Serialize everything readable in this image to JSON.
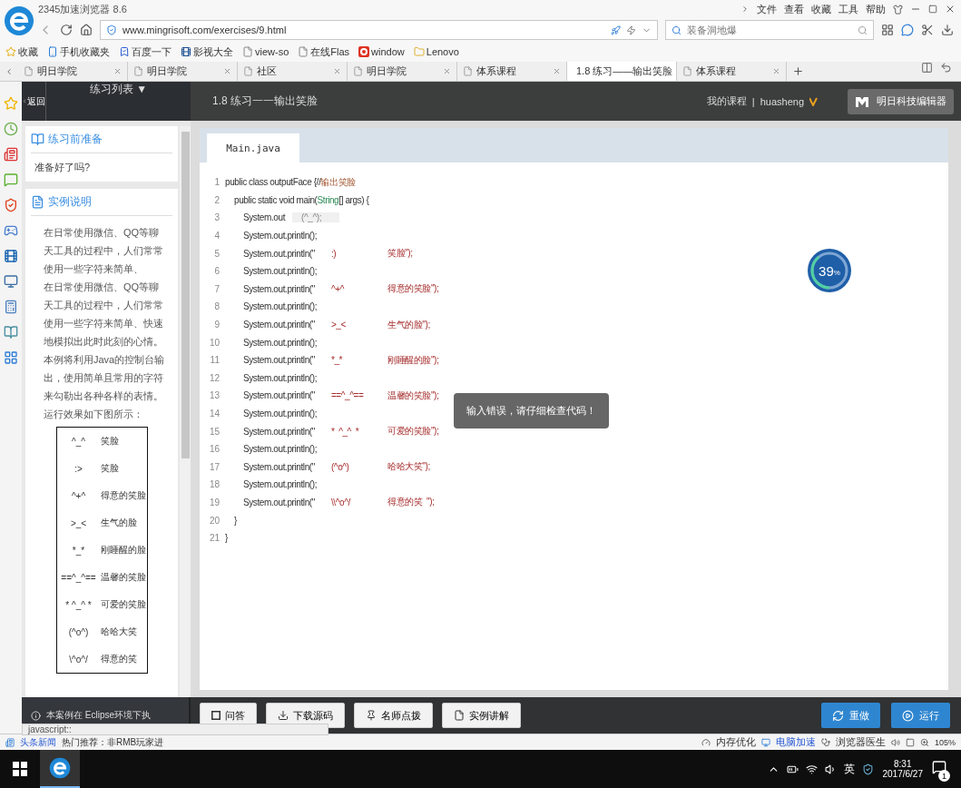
{
  "browser": {
    "title": "2345加速浏览器 8.6",
    "menu": [
      "文件",
      "查看",
      "收藏",
      "工具",
      "帮助"
    ],
    "address": "www.mingrisoft.com/exercises/9.html",
    "search": {
      "placeholder": "装备洞地爆"
    },
    "bookmarks": [
      {
        "label": "收藏",
        "kind": "star"
      },
      {
        "label": "手机收藏夹",
        "kind": "phone"
      },
      {
        "label": "百度一下",
        "kind": "paw"
      },
      {
        "label": "影视大全",
        "kind": "film"
      },
      {
        "label": "view-so",
        "kind": "page"
      },
      {
        "label": "在线Flas",
        "kind": "page"
      },
      {
        "label": "window",
        "kind": "red"
      },
      {
        "label": "Lenovo",
        "kind": "folder"
      }
    ],
    "tabs": [
      {
        "label": "明日学院",
        "selected": false
      },
      {
        "label": "明日学院",
        "selected": false
      },
      {
        "label": "社区",
        "selected": false
      },
      {
        "label": "明日学院",
        "selected": false
      },
      {
        "label": "体系课程",
        "selected": false
      },
      {
        "label": "1.8 练习——输出笑脸",
        "selected": true
      },
      {
        "label": "体系课程",
        "selected": false
      }
    ]
  },
  "header": {
    "back": "返回",
    "list_menu": "练习列表 ▼",
    "title": "1.8 练习一一输出笑脸",
    "my_courses": "我的课程",
    "separator": "|",
    "user": "huasheng",
    "editor_button": "明日科技编辑器"
  },
  "sidebar": {
    "prep": {
      "title": "练习前准备",
      "text": "准备好了吗?"
    },
    "example": {
      "title": "实例说明",
      "paragraphs": [
        "在日常使用微信、QQ等聊天工具的过程中，人们常常使用一些字符来简单、",
        "在日常使用微信、QQ等聊天工具的过程中，人们常常使用一些字符来简单、快速地模拟出此时此刻的心情。本例将利用Java的控制台输出，使用简单且常用的字符来勾勒出各种各样的表情。运行效果如下图所示："
      ],
      "faces": [
        {
          "face": "^_^",
          "meaning": "笑脸"
        },
        {
          "face": ":>",
          "meaning": "笑脸"
        },
        {
          "face": "^+^",
          "meaning": "得意的笑脸"
        },
        {
          "face": ">_<",
          "meaning": "生气的脸"
        },
        {
          "face": "*_*",
          "meaning": "刚睡醒的脸"
        },
        {
          "face": "==^_^==",
          "meaning": "温馨的笑脸"
        },
        {
          "face": "* ^_^ *",
          "meaning": "可爱的笑脸"
        },
        {
          "face": "(^o^)",
          "meaning": "哈哈大笑"
        },
        {
          "face": "\\^o^/",
          "meaning": "得意的笑"
        }
      ]
    },
    "footer": "本案例在 Eclipse环境下执"
  },
  "editor": {
    "file_tab": {
      "label": "Main.java",
      "selected": true
    },
    "lines": [
      {
        "number": "1",
        "kind": "class",
        "parts": [
          {
            "kind": "plain",
            "text": "public class outputFace {//"
          },
          {
            "kind": "comment",
            "text": "输出笑脸"
          }
        ]
      },
      {
        "number": "2",
        "kind": "method",
        "parts": [
          {
            "kind": "plain",
            "text": "public static void main("
          },
          {
            "kind": "type",
            "text": "String"
          },
          {
            "kind": "plain",
            "text": "[] args) {"
          }
        ]
      },
      {
        "number": "3",
        "kind": "statement",
        "parts": [
          {
            "kind": "plain",
            "text": "System.out"
          },
          {
            "kind": "highlight",
            "text": "(^_^);"
          }
        ]
      },
      {
        "number": "4",
        "kind": "statement",
        "parts": [
          {
            "kind": "plain",
            "text": "System.out.println();"
          }
        ]
      },
      {
        "number": "5",
        "kind": "statement",
        "parts": [
          {
            "kind": "plain",
            "text": "System.out.println(\""
          },
          {
            "kind": "face",
            "text": ":)"
          },
          {
            "kind": "label",
            "text": "笑脸\");"
          }
        ]
      },
      {
        "number": "6",
        "kind": "statement",
        "parts": [
          {
            "kind": "plain",
            "text": "System.out.println();"
          }
        ]
      },
      {
        "number": "7",
        "kind": "statement",
        "parts": [
          {
            "kind": "plain",
            "text": "System.out.println(\""
          },
          {
            "kind": "face",
            "text": "^+^"
          },
          {
            "kind": "label",
            "text": "得意的笑脸\");"
          }
        ]
      },
      {
        "number": "8",
        "kind": "statement",
        "parts": [
          {
            "kind": "plain",
            "text": "System.out.println();"
          }
        ]
      },
      {
        "number": "9",
        "kind": "statement",
        "parts": [
          {
            "kind": "plain",
            "text": "System.out.println(\""
          },
          {
            "kind": "face",
            "text": ">_<"
          },
          {
            "kind": "label",
            "text": "生气的脸\");"
          }
        ]
      },
      {
        "number": "10",
        "kind": "statement",
        "parts": [
          {
            "kind": "plain",
            "text": "System.out.println();"
          }
        ]
      },
      {
        "number": "11",
        "kind": "statement",
        "parts": [
          {
            "kind": "plain",
            "text": "System.out.println(\""
          },
          {
            "kind": "face",
            "text": "*_*"
          },
          {
            "kind": "label",
            "text": "刚睡醒的脸\");"
          }
        ]
      },
      {
        "number": "12",
        "kind": "statement",
        "parts": [
          {
            "kind": "plain",
            "text": "System.out.println();"
          }
        ]
      },
      {
        "number": "13",
        "kind": "statement",
        "parts": [
          {
            "kind": "plain",
            "text": "System.out.println(\""
          },
          {
            "kind": "face",
            "text": "==^_^=="
          },
          {
            "kind": "label",
            "text": "温馨的笑脸\");"
          }
        ]
      },
      {
        "number": "14",
        "kind": "statement",
        "parts": [
          {
            "kind": "plain",
            "text": "System.out.println();"
          }
        ]
      },
      {
        "number": "15",
        "kind": "statement",
        "parts": [
          {
            "kind": "plain",
            "text": "System.out.println(\""
          },
          {
            "kind": "face",
            "text": "*  ^_^  *"
          },
          {
            "kind": "label",
            "text": "可爱的笑脸\");"
          }
        ]
      },
      {
        "number": "16",
        "kind": "statement",
        "parts": [
          {
            "kind": "plain",
            "text": "System.out.println();"
          }
        ]
      },
      {
        "number": "17",
        "kind": "statement",
        "parts": [
          {
            "kind": "plain",
            "text": "System.out.println(\""
          },
          {
            "kind": "face",
            "text": "(^o^)"
          },
          {
            "kind": "label",
            "text": "哈哈大笑\");"
          }
        ]
      },
      {
        "number": "18",
        "kind": "statement",
        "parts": [
          {
            "kind": "plain",
            "text": "System.out.println();"
          }
        ]
      },
      {
        "number": "19",
        "kind": "statement",
        "parts": [
          {
            "kind": "plain",
            "text": "System.out.println(\""
          },
          {
            "kind": "face",
            "text": "\\\\^o^/"
          },
          {
            "kind": "label",
            "text": "得意的笑  \");"
          }
        ]
      },
      {
        "number": "20",
        "kind": "method",
        "parts": [
          {
            "kind": "plain",
            "text": "}"
          }
        ]
      },
      {
        "number": "21",
        "kind": "class",
        "parts": [
          {
            "kind": "plain",
            "text": "}"
          }
        ]
      }
    ],
    "toast": "输入错误，请仔细检查代码！",
    "progress": {
      "label": "39",
      "unit": "%",
      "level": 0.39
    }
  },
  "toolbar": {
    "buttons": [
      {
        "label": "问答",
        "kind": "square"
      },
      {
        "label": "下载源码",
        "kind": "download"
      },
      {
        "label": "名师点拨",
        "kind": "pin"
      },
      {
        "label": "实例讲解",
        "kind": "file"
      }
    ],
    "actions": [
      {
        "label": "重做",
        "kind": "redo"
      },
      {
        "label": "运行",
        "kind": "run"
      }
    ]
  },
  "link_preview": "javascript::",
  "status_bar": {
    "news": "头条新闻",
    "hot": "热门推荐：非RMB玩家进",
    "tools": [
      "内存优化",
      "电脑加速",
      "浏览器医生"
    ],
    "zoom": "105%"
  },
  "taskbar": {
    "ime": "英",
    "time": "8:31",
    "date": "2017/6/27",
    "notifications": "1"
  }
}
